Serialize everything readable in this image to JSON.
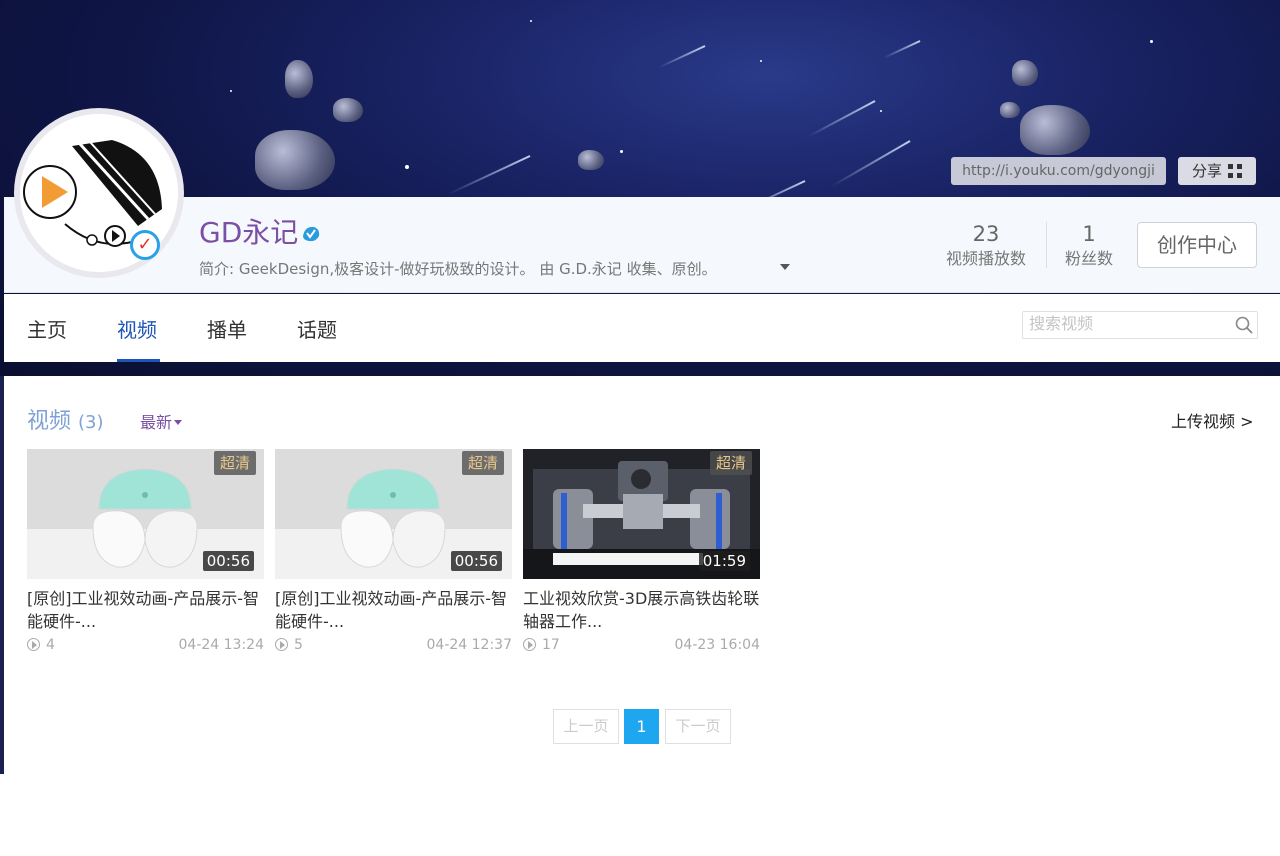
{
  "header": {
    "profile_url": "http://i.youku.com/gdyongji",
    "share_label": "分享"
  },
  "profile": {
    "name": "GD永记",
    "intro": "简介: GeekDesign,极客设计-做好玩极致的设计。 由 G.D.永记 收集、原创。",
    "stats": [
      {
        "value": "23",
        "label": "视频播放数"
      },
      {
        "value": "1",
        "label": "粉丝数"
      }
    ],
    "creator_button": "创作中心"
  },
  "tabs": [
    {
      "label": "主页"
    },
    {
      "label": "视频",
      "active": true
    },
    {
      "label": "播单"
    },
    {
      "label": "话题"
    }
  ],
  "search": {
    "placeholder": "搜索视频"
  },
  "section": {
    "title": "视频",
    "count": "(3)",
    "sort": "最新",
    "upload": "上传视频 >"
  },
  "videos": [
    {
      "badge": "超清",
      "duration": "00:56",
      "title": "[原创]工业视效动画-产品展示-智能硬件-...",
      "plays": "4",
      "date": "04-24 13:24"
    },
    {
      "badge": "超清",
      "duration": "00:56",
      "title": "[原创]工业视效动画-产品展示-智能硬件-...",
      "plays": "5",
      "date": "04-24 12:37"
    },
    {
      "badge": "超清",
      "duration": "01:59",
      "title": "工业视效欣赏-3D展示高铁齿轮联轴器工作...",
      "plays": "17",
      "date": "04-23 16:04"
    }
  ],
  "pager": {
    "prev": "上一页",
    "current": "1",
    "next": "下一页"
  },
  "colors": {
    "accent_blue": "#1d56b8",
    "name_purple": "#7b4fa3",
    "pager_active": "#1ea7f0"
  }
}
